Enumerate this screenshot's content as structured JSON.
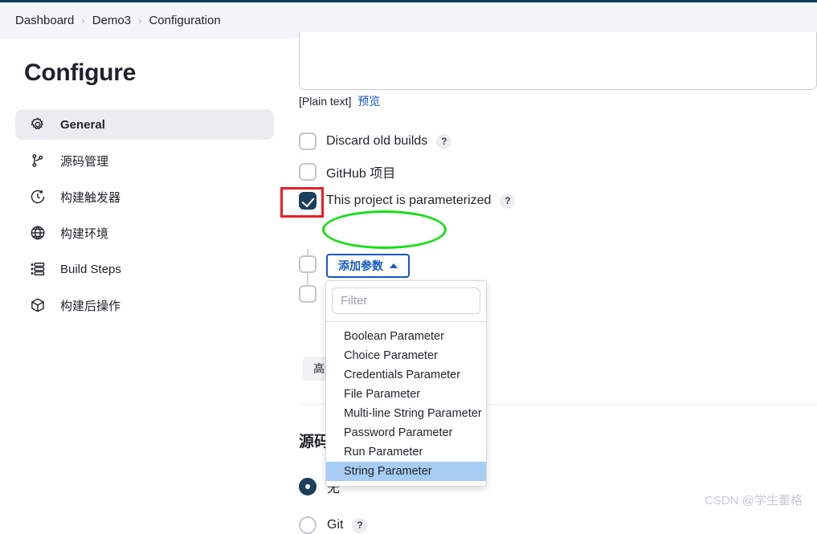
{
  "breadcrumb": {
    "items": [
      "Dashboard",
      "Demo3",
      "Configuration"
    ],
    "separator": "›"
  },
  "sidebar": {
    "title": "Configure",
    "items": [
      {
        "label": "General",
        "icon": "gear-icon",
        "active": true
      },
      {
        "label": "源码管理",
        "icon": "source-branch-icon",
        "active": false
      },
      {
        "label": "构建触发器",
        "icon": "clock-icon",
        "active": false
      },
      {
        "label": "构建环境",
        "icon": "globe-icon",
        "active": false
      },
      {
        "label": "Build Steps",
        "icon": "list-steps-icon",
        "active": false
      },
      {
        "label": "构建后操作",
        "icon": "package-icon",
        "active": false
      }
    ]
  },
  "main": {
    "description_format": "[Plain text]",
    "preview_link": "预览",
    "checkboxes": [
      {
        "label": "Discard old builds",
        "checked": false,
        "help": "?"
      },
      {
        "label": "GitHub 项目",
        "checked": false,
        "help": ""
      },
      {
        "label": "This project is parameterized",
        "checked": true,
        "help": "?"
      }
    ],
    "add_parameter_button": "添加参数",
    "advanced_button": "高级",
    "section_heading": "源码",
    "radios": [
      {
        "label": "无",
        "selected": true,
        "help": ""
      },
      {
        "label": "Git",
        "selected": false,
        "help": "?"
      }
    ]
  },
  "dropdown": {
    "filter_placeholder": "Filter",
    "filter_value": "",
    "options": [
      {
        "label": "Boolean Parameter",
        "highlighted": false
      },
      {
        "label": "Choice Parameter",
        "highlighted": false
      },
      {
        "label": "Credentials Parameter",
        "highlighted": false
      },
      {
        "label": "File Parameter",
        "highlighted": false
      },
      {
        "label": "Multi-line String Parameter",
        "highlighted": false
      },
      {
        "label": "Password Parameter",
        "highlighted": false
      },
      {
        "label": "Run Parameter",
        "highlighted": false
      },
      {
        "label": "String Parameter",
        "highlighted": true
      }
    ]
  },
  "annotations": {
    "rect_color": "#ec1c24",
    "ellipse_color": "#14e014"
  },
  "watermark": "CSDN @学生董格",
  "colors": {
    "accent_blue": "#1559c0",
    "checkbox_checked": "#1d3f5b",
    "link": "#1355c1",
    "highlight": "#a8cdf4"
  }
}
